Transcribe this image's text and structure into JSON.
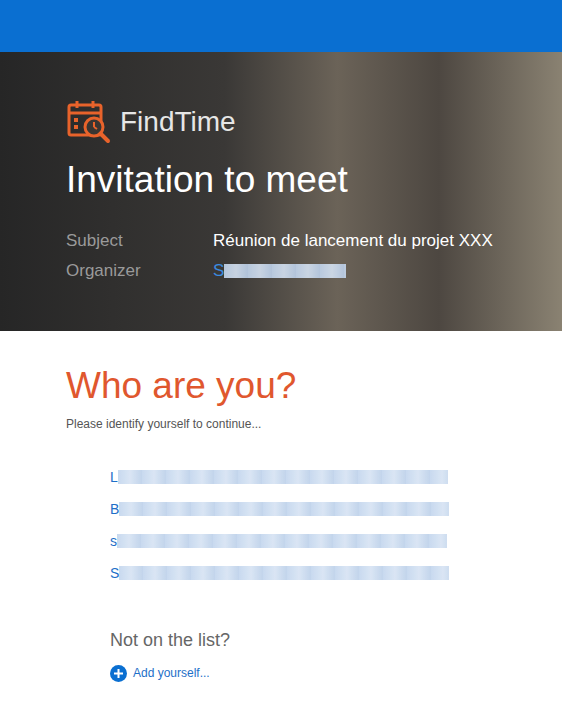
{
  "app": {
    "name": "FindTime"
  },
  "header": {
    "title": "Invitation to meet",
    "fields": [
      {
        "label": "Subject",
        "value": "Réunion de lancement du projet XXX",
        "redacted": false
      },
      {
        "label": "Organizer",
        "value": "S",
        "redacted": true
      }
    ]
  },
  "identify": {
    "title": "Who are you?",
    "prompt": "Please identify yourself to continue...",
    "people": [
      {
        "name": "L",
        "redacted": true
      },
      {
        "name": "B",
        "redacted": true
      },
      {
        "name": "s",
        "redacted": true
      },
      {
        "name": "S",
        "redacted": true
      }
    ],
    "not_listed": "Not on the list?",
    "add_link": "Add yourself..."
  }
}
